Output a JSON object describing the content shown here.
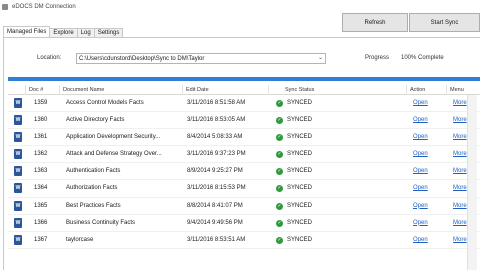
{
  "window": {
    "title": "eDOCS DM Connection"
  },
  "toolbar": {
    "refresh_label": "Refresh",
    "start_sync_label": "Start Sync"
  },
  "tabs": [
    {
      "label": "Managed Files",
      "active": true
    },
    {
      "label": "Explore",
      "active": false
    },
    {
      "label": "Log",
      "active": false
    },
    {
      "label": "Settings",
      "active": false
    }
  ],
  "location": {
    "label": "Location:",
    "value": "C:\\Users\\cdunstord\\Desktop\\Sync to DM\\Taylor"
  },
  "progress": {
    "label": "Progress",
    "value_text": "100% Complete",
    "fraction": 1.0,
    "color": "#2f7fd4"
  },
  "grid": {
    "headers": {
      "doc_num": "Doc #",
      "doc_name": "Document Name",
      "edit_date": "Edit Date",
      "sync_status": "Sync Status",
      "action": "Action",
      "menu": "Menu"
    },
    "rows": [
      {
        "doc_num": "1359",
        "name": "Access Control Models Facts",
        "date": "3/11/2016 8:51:58 AM",
        "status": "SYNCED",
        "action": "Open",
        "menu": "More"
      },
      {
        "doc_num": "1360",
        "name": "Active Directory Facts",
        "date": "3/11/2016 8:53:05 AM",
        "status": "SYNCED",
        "action": "Open",
        "menu": "More"
      },
      {
        "doc_num": "1361",
        "name": "Application Development Security...",
        "date": "8/4/2014 5:08:33 AM",
        "status": "SYNCED",
        "action": "Open",
        "menu": "More"
      },
      {
        "doc_num": "1362",
        "name": "Attack and Defense Strategy Over...",
        "date": "3/11/2016 9:37:23 PM",
        "status": "SYNCED",
        "action": "Open",
        "menu": "More"
      },
      {
        "doc_num": "1363",
        "name": "Authentication Facts",
        "date": "8/9/2014 9:25:27 PM",
        "status": "SYNCED",
        "action": "Open",
        "menu": "More"
      },
      {
        "doc_num": "1364",
        "name": "Authorization Facts",
        "date": "3/11/2016 8:15:53 PM",
        "status": "SYNCED",
        "action": "Open",
        "menu": "More"
      },
      {
        "doc_num": "1365",
        "name": "Best Practices Facts",
        "date": "8/8/2014 8:41:07 PM",
        "status": "SYNCED",
        "action": "Open",
        "menu": "More"
      },
      {
        "doc_num": "1366",
        "name": "Business Continuity Facts",
        "date": "9/4/2014 9:49:56 PM",
        "status": "SYNCED",
        "action": "Open",
        "menu": "More"
      },
      {
        "doc_num": "1367",
        "name": "taylorcase",
        "date": "3/11/2016 8:53:51 AM",
        "status": "SYNCED",
        "action": "Open",
        "menu": "More"
      }
    ]
  },
  "icons": {
    "doc": "word-document-icon",
    "status": "green-check-icon",
    "doc_glyph": "W",
    "check_glyph": "✓",
    "chevron_glyph": "⌄"
  },
  "colors": {
    "synced": "#2e9a3c",
    "link": "#1f5fbf",
    "word": "#2b579a"
  }
}
